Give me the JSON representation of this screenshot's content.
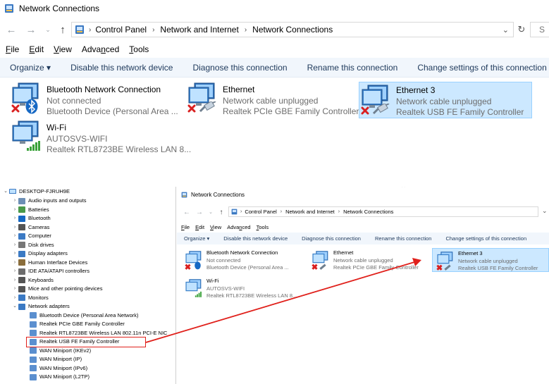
{
  "window": {
    "title": "Network Connections",
    "search_hint": "S"
  },
  "address": {
    "crumbs": [
      "Control Panel",
      "Network and Internet",
      "Network Connections"
    ]
  },
  "menu": [
    {
      "label": "File",
      "key": "F",
      "rest": "ile"
    },
    {
      "label": "Edit",
      "key": "E",
      "rest": "dit"
    },
    {
      "label": "View",
      "key": "V",
      "rest": "iew"
    },
    {
      "label": "Advanced",
      "pre": "Adva",
      "key": "n",
      "rest": "ced"
    },
    {
      "label": "Tools",
      "key": "T",
      "rest": "ools"
    }
  ],
  "commands": {
    "organize": "Organize ▾",
    "disable": "Disable this network device",
    "diagnose": "Diagnose this connection",
    "rename": "Rename this connection",
    "change": "Change settings of this connection"
  },
  "connections": [
    {
      "name": "Bluetooth Network Connection",
      "status": "Not connected",
      "device": "Bluetooth Device (Personal Area ...",
      "type": "bluetooth",
      "state": "disconnected"
    },
    {
      "name": "Ethernet",
      "status": "Network cable unplugged",
      "device": "Realtek PCIe GBE Family Controller",
      "type": "ethernet",
      "state": "disconnected"
    },
    {
      "name": "Ethernet 3",
      "status": "Network cable unplugged",
      "device": "Realtek USB FE Family Controller",
      "type": "ethernet",
      "state": "disconnected",
      "selected": true
    },
    {
      "name": "Wi-Fi",
      "status": "AUTOSVS-WIFI",
      "device": "Realtek RTL8723BE Wireless LAN 8...",
      "type": "wifi",
      "state": "connected"
    }
  ],
  "device_manager": {
    "root": "DESKTOP-FJRUH9E",
    "categories": [
      "Audio inputs and outputs",
      "Batteries",
      "Bluetooth",
      "Cameras",
      "Computer",
      "Disk drives",
      "Display adapters",
      "Human Interface Devices",
      "IDE ATA/ATAPI controllers",
      "Keyboards",
      "Mice and other pointing devices",
      "Monitors",
      "Network adapters"
    ],
    "network_adapters": [
      "Bluetooth Device (Personal Area Network)",
      "Realtek PCIe GBE Family Controller",
      "Realtek RTL8723BE Wireless LAN 802.11n PCI-E NIC",
      "Realtek USB FE Family Controller",
      "WAN Miniport (IKEv2)",
      "WAN Miniport (IP)",
      "WAN Miniport (IPv6)",
      "WAN Miniport (L2TP)"
    ],
    "highlighted": "Realtek USB FE Family Controller"
  },
  "small_window": {
    "title": "Network Connections",
    "device_names": [
      "Bluetooth Device (Personal Area ...",
      "Realtek PCIe GBE Family Controller",
      "Realtek USB FE Family Controller",
      "Realtek RTL8723BE Wireless LAN 8..."
    ]
  },
  "colors": {
    "selection_bg": "#cce8ff",
    "command_bar_bg": "#f1f6fc",
    "command_text": "#1e395b",
    "annotation_red": "#e0201b",
    "subtext": "#6d6d6d"
  },
  "icons": {
    "monitor": "network-monitor-icon",
    "error": "red-x-icon",
    "bluetooth": "bluetooth-icon",
    "cable": "ethernet-cable-icon",
    "signal": "wifi-signal-icon"
  }
}
